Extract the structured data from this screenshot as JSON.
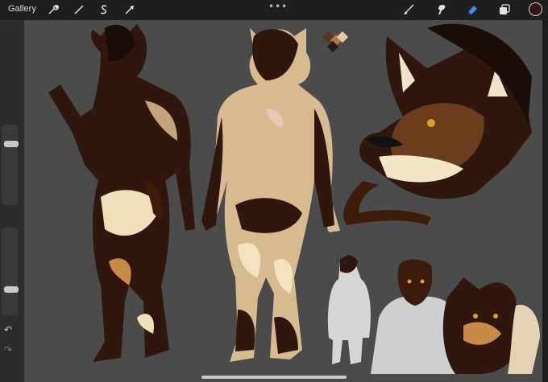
{
  "topbar": {
    "gallery_label": "Gallery",
    "more_glyph": "•••",
    "left_tools": [
      "wrench-icon",
      "magic-wand-icon",
      "selection-s-icon",
      "transform-arrow-icon"
    ],
    "right_tools": [
      "brush-icon",
      "smudge-icon",
      "eraser-icon",
      "layers-icon"
    ],
    "active_tool": "eraser-icon",
    "current_color": "#3a1414",
    "accent_color": "#3e8cf0"
  },
  "sidebar": {
    "brush_size_level": 0.22,
    "opacity_level": 0.72,
    "undo_glyph": "↶",
    "redo_glyph": "↷"
  },
  "canvas": {
    "background": "#4b4b4b",
    "palette_swatches": [
      "#5a3620",
      "#b07a40",
      "#e8c9a0",
      "#2b1a12"
    ]
  }
}
